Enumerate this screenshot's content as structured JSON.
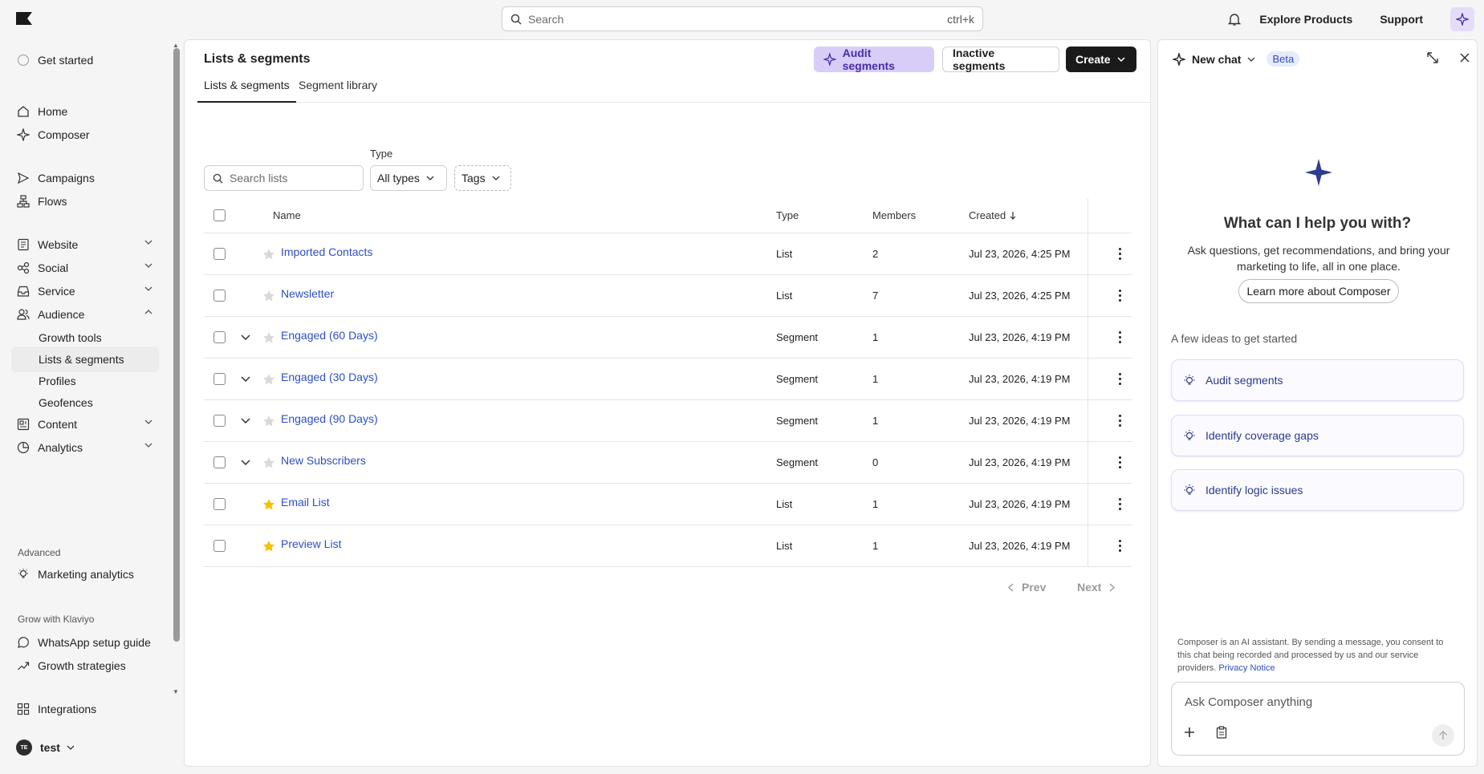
{
  "topbar": {
    "search_placeholder": "Search",
    "search_shortcut": "ctrl+k",
    "explore_label": "Explore Products",
    "support_label": "Support"
  },
  "sidebar": {
    "get_started": "Get started",
    "items": [
      {
        "label": "Home",
        "icon": "home-icon"
      },
      {
        "label": "Composer",
        "icon": "sparkle-icon"
      },
      {
        "label": "Campaigns",
        "icon": "send-icon"
      },
      {
        "label": "Flows",
        "icon": "flows-icon"
      },
      {
        "label": "Website",
        "icon": "document-icon"
      },
      {
        "label": "Social",
        "icon": "social-icon"
      },
      {
        "label": "Service",
        "icon": "inbox-icon"
      },
      {
        "label": "Audience",
        "icon": "users-icon"
      },
      {
        "label": "Content",
        "icon": "content-icon"
      },
      {
        "label": "Analytics",
        "icon": "chart-icon"
      }
    ],
    "audience_sub": [
      "Growth tools",
      "Lists & segments",
      "Profiles",
      "Geofences"
    ],
    "advanced_label": "Advanced",
    "marketing_analytics": "Marketing analytics",
    "grow_label": "Grow with Klaviyo",
    "whatsapp": "WhatsApp setup guide",
    "growth_strategies": "Growth strategies",
    "integrations": "Integrations",
    "user_initials": "TE",
    "user_name": "test"
  },
  "main": {
    "title": "Lists & segments",
    "audit_button": "Audit segments",
    "inactive_button": "Inactive segments",
    "create_button": "Create",
    "tabs": [
      "Lists & segments",
      "Segment library"
    ],
    "type_label": "Type",
    "search_placeholder": "Search lists",
    "type_select": "All types",
    "tags_select": "Tags",
    "columns": {
      "name": "Name",
      "type": "Type",
      "members": "Members",
      "created": "Created"
    },
    "rows": [
      {
        "name": "Imported Contacts",
        "type": "List",
        "members": "2",
        "created": "Jul 23, 2026, 4:25 PM",
        "starred": false,
        "expandable": false
      },
      {
        "name": "Newsletter",
        "type": "List",
        "members": "7",
        "created": "Jul 23, 2026, 4:25 PM",
        "starred": false,
        "expandable": false
      },
      {
        "name": "Engaged (60 Days)",
        "type": "Segment",
        "members": "1",
        "created": "Jul 23, 2026, 4:19 PM",
        "starred": false,
        "expandable": true
      },
      {
        "name": "Engaged (30 Days)",
        "type": "Segment",
        "members": "1",
        "created": "Jul 23, 2026, 4:19 PM",
        "starred": false,
        "expandable": true
      },
      {
        "name": "Engaged (90 Days)",
        "type": "Segment",
        "members": "1",
        "created": "Jul 23, 2026, 4:19 PM",
        "starred": false,
        "expandable": true
      },
      {
        "name": "New Subscribers",
        "type": "Segment",
        "members": "0",
        "created": "Jul 23, 2026, 4:19 PM",
        "starred": false,
        "expandable": true
      },
      {
        "name": "Email List",
        "type": "List",
        "members": "1",
        "created": "Jul 23, 2026, 4:19 PM",
        "starred": true,
        "expandable": false
      },
      {
        "name": "Preview List",
        "type": "List",
        "members": "1",
        "created": "Jul 23, 2026, 4:19 PM",
        "starred": true,
        "expandable": false
      }
    ],
    "prev_label": "Prev",
    "next_label": "Next"
  },
  "chat": {
    "title": "New chat",
    "beta": "Beta",
    "heading": "What can I help you with?",
    "subtext": "Ask questions, get recommendations, and bring your marketing to life, all in one place.",
    "learn_button": "Learn more about Composer",
    "ideas_label": "A few ideas to get started",
    "ideas": [
      "Audit segments",
      "Identify coverage gaps",
      "Identify logic issues"
    ],
    "disclaimer": "Composer is an AI assistant. By sending a message, you consent to this chat being recorded and processed by us and our service providers.",
    "privacy_link": "Privacy Notice",
    "input_placeholder": "Ask Composer anything"
  },
  "colors": {
    "accent_purple": "#d8cdf7",
    "link_blue": "#2d4fc5",
    "star_gold": "#f2c200",
    "sparkle_navy": "#2f3d8f"
  }
}
